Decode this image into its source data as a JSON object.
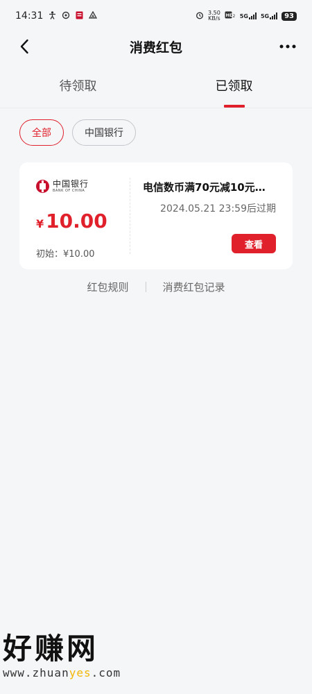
{
  "status_bar": {
    "time": "14:31",
    "net_speed_top": "3.50",
    "net_speed_bottom": "KB/s",
    "net_1": "5G",
    "net_2": "5G",
    "battery": "93",
    "icons": [
      "figure-icon",
      "vpn-icon",
      "app-icon",
      "triangle-icon",
      "alarm-icon",
      "hd-icon",
      "signal-icon",
      "wifi-icon",
      "battery-icon"
    ]
  },
  "header": {
    "title": "消费红包"
  },
  "tabs": [
    {
      "label": "待领取",
      "active": false
    },
    {
      "label": "已领取",
      "active": true
    }
  ],
  "filters": [
    {
      "label": "全部",
      "active": true
    },
    {
      "label": "中国银行",
      "active": false
    }
  ],
  "card": {
    "bank_cn": "中国银行",
    "bank_en": "BANK OF CHINA",
    "currency": "¥",
    "amount": "10.00",
    "initial": "初始：¥10.00",
    "title": "电信数币满70元减10元…",
    "expire": "2024.05.21 23:59后过期",
    "button": "查看"
  },
  "links": {
    "rules": "红包规则",
    "records": "消费红包记录"
  },
  "watermark": {
    "cn": "好赚网",
    "url_prefix": "www.zhuan",
    "url_accent": "yes",
    "url_suffix": ".com"
  },
  "colors": {
    "accent": "#e0212c",
    "background": "#f5f6f8"
  }
}
